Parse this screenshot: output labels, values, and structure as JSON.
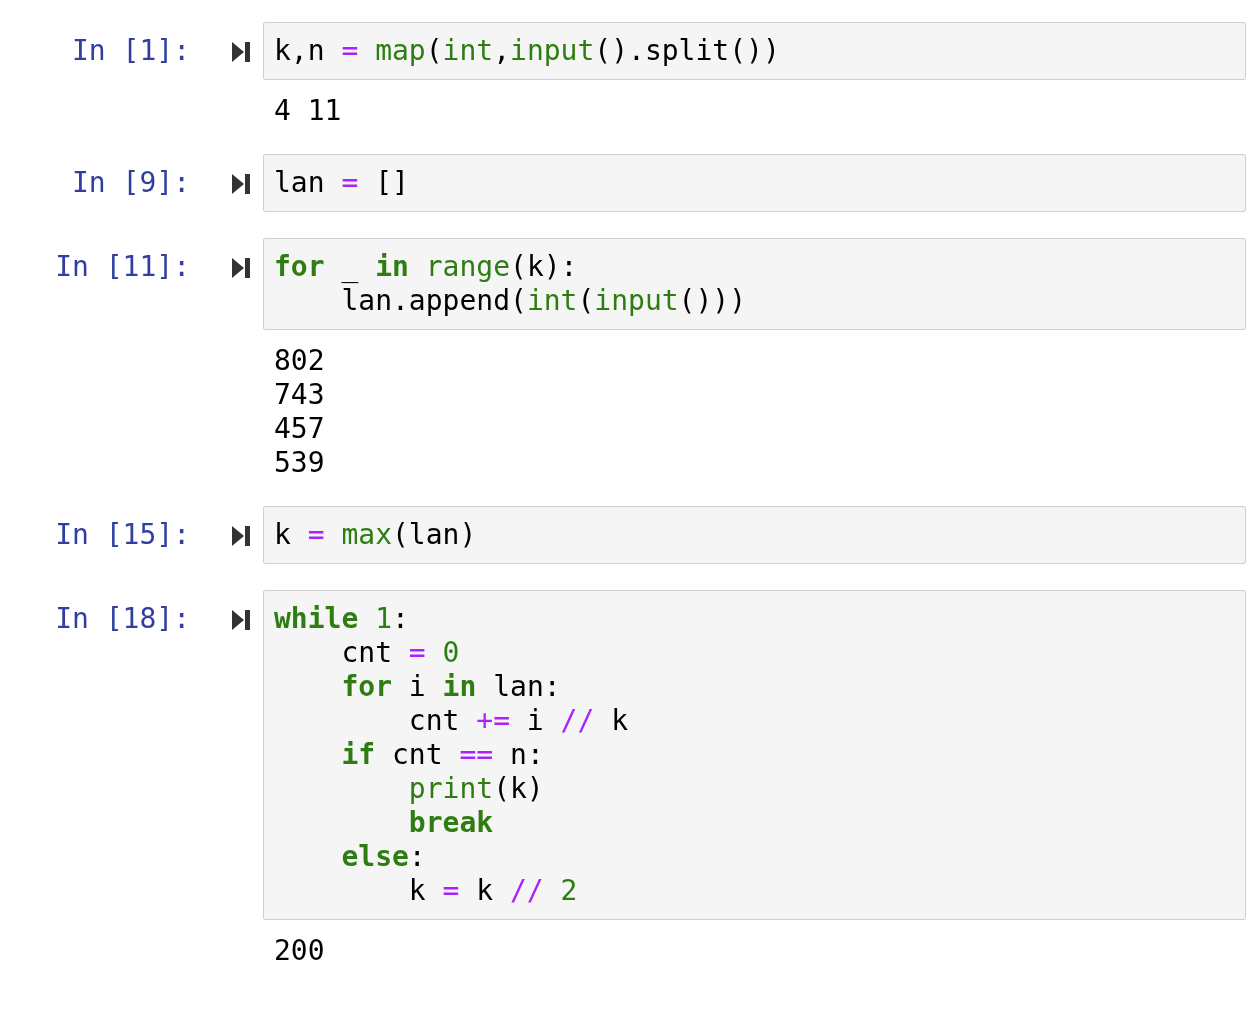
{
  "cells": [
    {
      "prompt": "In [1]:",
      "lines": [
        [
          {
            "kind": "text",
            "t": "k,n "
          },
          {
            "kind": "op",
            "t": "="
          },
          {
            "kind": "builtin",
            "t": " map"
          },
          {
            "kind": "text",
            "t": "("
          },
          {
            "kind": "builtin",
            "t": "int"
          },
          {
            "kind": "text",
            "t": ","
          },
          {
            "kind": "builtin",
            "t": "input"
          },
          {
            "kind": "text",
            "t": "().split())"
          }
        ]
      ],
      "output": [
        "4 11"
      ]
    },
    {
      "prompt": "In [9]:",
      "lines": [
        [
          {
            "kind": "text",
            "t": "lan "
          },
          {
            "kind": "op",
            "t": "="
          },
          {
            "kind": "text",
            "t": " []"
          }
        ]
      ]
    },
    {
      "prompt": "In [11]:",
      "lines": [
        [
          {
            "kind": "kw",
            "t": "for"
          },
          {
            "kind": "text",
            "t": " _ "
          },
          {
            "kind": "kw",
            "t": "in"
          },
          {
            "kind": "builtin",
            "t": " range"
          },
          {
            "kind": "text",
            "t": "(k):"
          }
        ],
        [
          {
            "kind": "text",
            "t": "    lan.append("
          },
          {
            "kind": "builtin",
            "t": "int"
          },
          {
            "kind": "text",
            "t": "("
          },
          {
            "kind": "builtin",
            "t": "input"
          },
          {
            "kind": "text",
            "t": "()))"
          }
        ]
      ],
      "output": [
        "802",
        "743",
        "457",
        "539"
      ]
    },
    {
      "prompt": "In [15]:",
      "lines": [
        [
          {
            "kind": "text",
            "t": "k "
          },
          {
            "kind": "op",
            "t": "="
          },
          {
            "kind": "builtin",
            "t": " max"
          },
          {
            "kind": "text",
            "t": "(lan)"
          }
        ]
      ]
    },
    {
      "prompt": "In [18]:",
      "lines": [
        [
          {
            "kind": "kw",
            "t": "while"
          },
          {
            "kind": "num",
            "t": " 1"
          },
          {
            "kind": "text",
            "t": ":"
          }
        ],
        [
          {
            "kind": "text",
            "t": "    cnt "
          },
          {
            "kind": "op",
            "t": "="
          },
          {
            "kind": "num",
            "t": " 0"
          }
        ],
        [
          {
            "kind": "kw",
            "t": "    for"
          },
          {
            "kind": "text",
            "t": " i "
          },
          {
            "kind": "kw",
            "t": "in"
          },
          {
            "kind": "text",
            "t": " lan:"
          }
        ],
        [
          {
            "kind": "text",
            "t": "        cnt "
          },
          {
            "kind": "op",
            "t": "+="
          },
          {
            "kind": "text",
            "t": " i "
          },
          {
            "kind": "op",
            "t": "//"
          },
          {
            "kind": "text",
            "t": " k"
          }
        ],
        [
          {
            "kind": "kw",
            "t": "    if"
          },
          {
            "kind": "text",
            "t": " cnt "
          },
          {
            "kind": "op",
            "t": "=="
          },
          {
            "kind": "text",
            "t": " n:"
          }
        ],
        [
          {
            "kind": "builtin",
            "t": "        print"
          },
          {
            "kind": "text",
            "t": "(k)"
          }
        ],
        [
          {
            "kind": "kw",
            "t": "        break"
          }
        ],
        [
          {
            "kind": "kw",
            "t": "    else"
          },
          {
            "kind": "text",
            "t": ":"
          }
        ],
        [
          {
            "kind": "text",
            "t": "        k "
          },
          {
            "kind": "op",
            "t": "="
          },
          {
            "kind": "text",
            "t": " k "
          },
          {
            "kind": "op",
            "t": "//"
          },
          {
            "kind": "num",
            "t": " 2"
          }
        ]
      ],
      "output": [
        "200"
      ]
    }
  ]
}
